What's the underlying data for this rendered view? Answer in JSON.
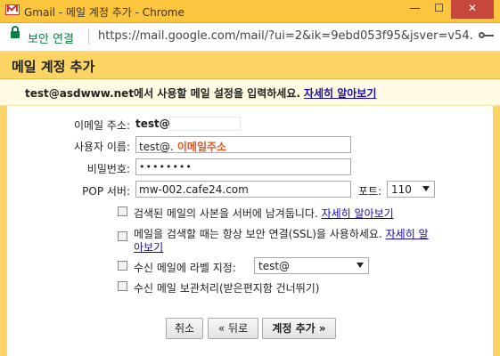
{
  "window": {
    "title": "Gmail - 메일 계정 추가 - Chrome",
    "minimize": "—",
    "maximize": "☐",
    "close": "✕"
  },
  "addressbar": {
    "secure_label": "보안 연결",
    "url": "https://mail.google.com/mail/?ui=2&ik=9ebd053f95&jsver=v54..."
  },
  "header": {
    "title": "메일 계정 추가"
  },
  "intro": {
    "text": "test@asdwww.net에서 사용할 메일 설정을 입력하세요.",
    "link": "자세히 알아보기"
  },
  "form": {
    "email_label": "이메일 주소:",
    "email_value": "test@",
    "username_label": "사용자 이름:",
    "username_value": "test@.",
    "username_hint": "이메일주소",
    "password_label": "비밀번호:",
    "password_value": "••••••••",
    "pop_label": "POP 서버:",
    "pop_value": "mw-002.cafe24.com",
    "port_label": "포트:",
    "port_value": "110",
    "options": [
      {
        "text": "검색된 메일의 사본을 서버에 남겨둡니다.",
        "link": "자세히 알아보기",
        "checked": false
      },
      {
        "text": "메일을 검색할 때는 항상 보안 연결(SSL)을 사용하세요.",
        "link": "자세히 알",
        "link2": "아보기",
        "checked": false
      },
      {
        "text": "수신 메일에 라벨 지정:",
        "select_value": "test@",
        "checked": false
      },
      {
        "text": "수신 메일 보관처리(받은편지함 건너뛰기)",
        "checked": false
      }
    ]
  },
  "buttons": {
    "cancel": "취소",
    "back": "« 뒤로",
    "add": "계정 추가 »"
  },
  "colors": {
    "header_bg": "#fcd565",
    "intro_bg": "#fffbe2",
    "link": "#1a0dab",
    "hint": "#e8541e",
    "secure": "#0b8043"
  }
}
